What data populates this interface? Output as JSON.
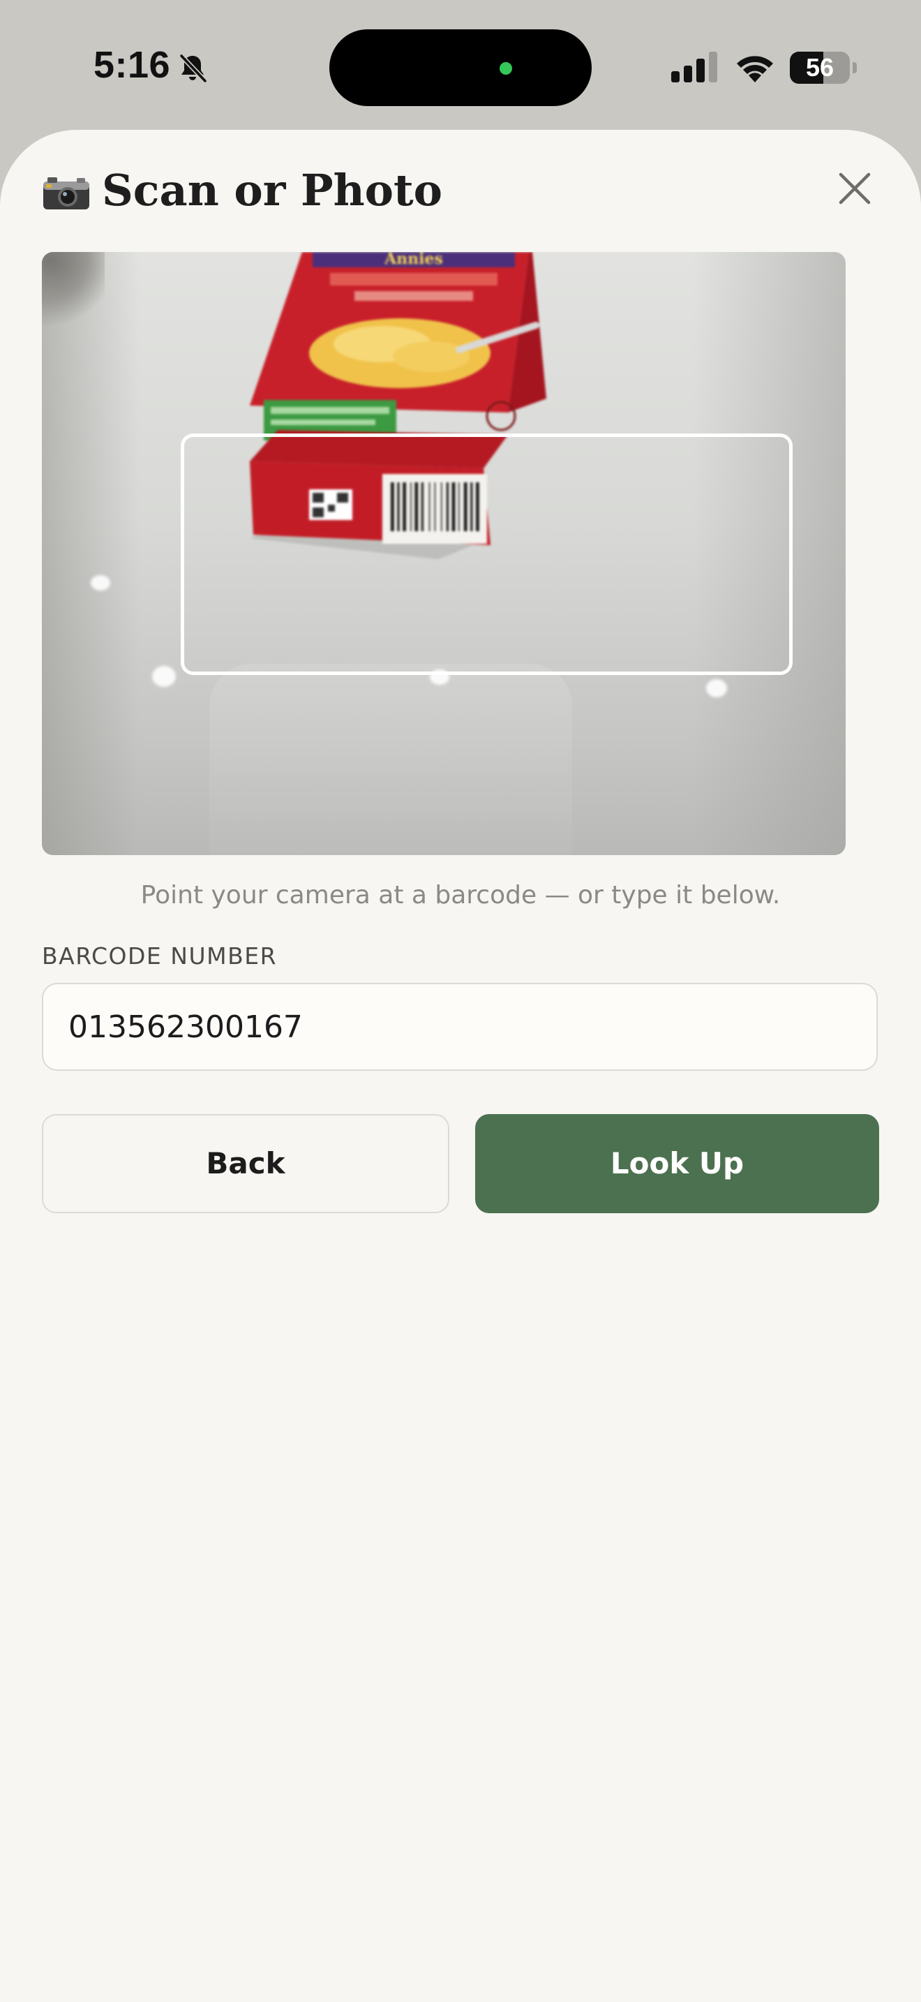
{
  "status_bar": {
    "time": "5:16",
    "battery_level": "56",
    "battery_fraction": 0.56,
    "icons": [
      "bell-slash-icon",
      "cellular-signal-icon",
      "wifi-icon",
      "battery-icon"
    ],
    "camera_in_use_color": "#34c759"
  },
  "sheet": {
    "title": "Scan or Photo",
    "title_icon": "camera-icon",
    "close_icon": "close-icon"
  },
  "scanner": {
    "preview": "camera-preview",
    "hint": "Point your camera at a barcode — or type it below."
  },
  "form": {
    "barcode_label": "BARCODE NUMBER",
    "barcode_value": "013562300167"
  },
  "actions": {
    "back_label": "Back",
    "lookup_label": "Look Up"
  },
  "colors": {
    "background": "#f7f6f2",
    "primary": "#4c7150",
    "hint_text": "#8a8985"
  }
}
